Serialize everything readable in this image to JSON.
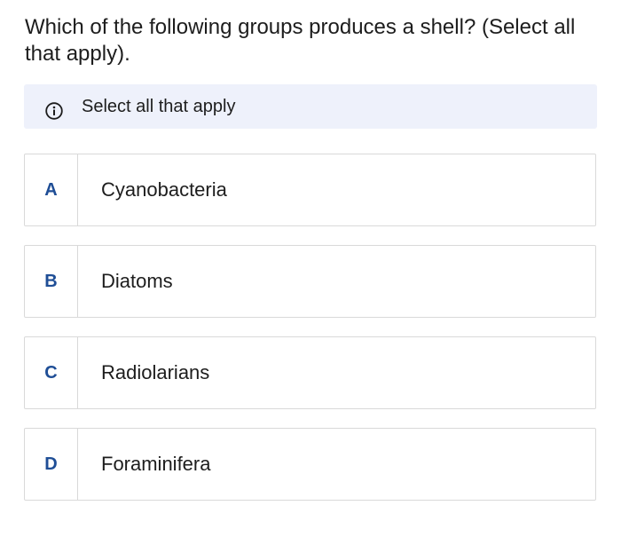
{
  "question": {
    "text": "Which of the following groups produces a shell? (Select all that apply)."
  },
  "hint": {
    "icon": "info-icon",
    "text": "Select all that apply"
  },
  "options": [
    {
      "letter": "A",
      "label": "Cyanobacteria"
    },
    {
      "letter": "B",
      "label": "Diatoms"
    },
    {
      "letter": "C",
      "label": "Radiolarians"
    },
    {
      "letter": "D",
      "label": "Foraminifera"
    }
  ],
  "colors": {
    "accent_letter": "#1f4e96",
    "hint_background": "#eef1fb",
    "border": "#d9d9d9"
  }
}
